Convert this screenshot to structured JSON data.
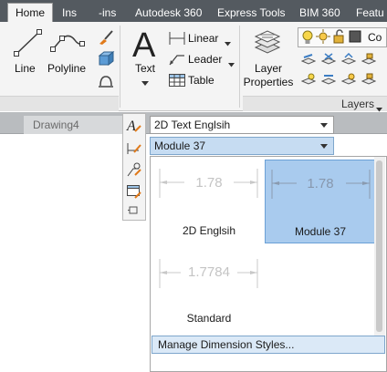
{
  "ribbon_tabs": {
    "home": "Home",
    "insert": "Ins",
    "addins": "-ins",
    "autodesk360": "Autodesk 360",
    "express_tools": "Express Tools",
    "bim360": "BIM 360",
    "featured": "Featu"
  },
  "draw_panel": {
    "line_label": "Line",
    "polyline_label": "Polyline"
  },
  "annotation_panel": {
    "text_label": "Text",
    "linear_label": "Linear",
    "leader_label": "Leader",
    "table_label": "Table"
  },
  "layers_panel": {
    "layer_properties_label": "Layer\nProperties",
    "layers_title": "Layers",
    "truncated_label": "Co"
  },
  "file_tab": {
    "label": "Drawing4"
  },
  "text_style_combo": {
    "value": "2D Text Englsih"
  },
  "dim_style_combo": {
    "value": "Module 37"
  },
  "gallery": {
    "items": [
      {
        "preview_value": "1.78",
        "caption": "2D Englsih",
        "selected": false
      },
      {
        "preview_value": "1.78",
        "caption": "Module 37",
        "selected": true
      },
      {
        "preview_value": "1.7784",
        "caption": "Standard",
        "selected": false
      }
    ],
    "manage_label": "Manage Dimension Styles..."
  },
  "colors": {
    "tabbar": "#545a60",
    "selection": "#a9cbee",
    "selection_border": "#6ba0d6",
    "combo_selected": "#c6dcf2"
  }
}
